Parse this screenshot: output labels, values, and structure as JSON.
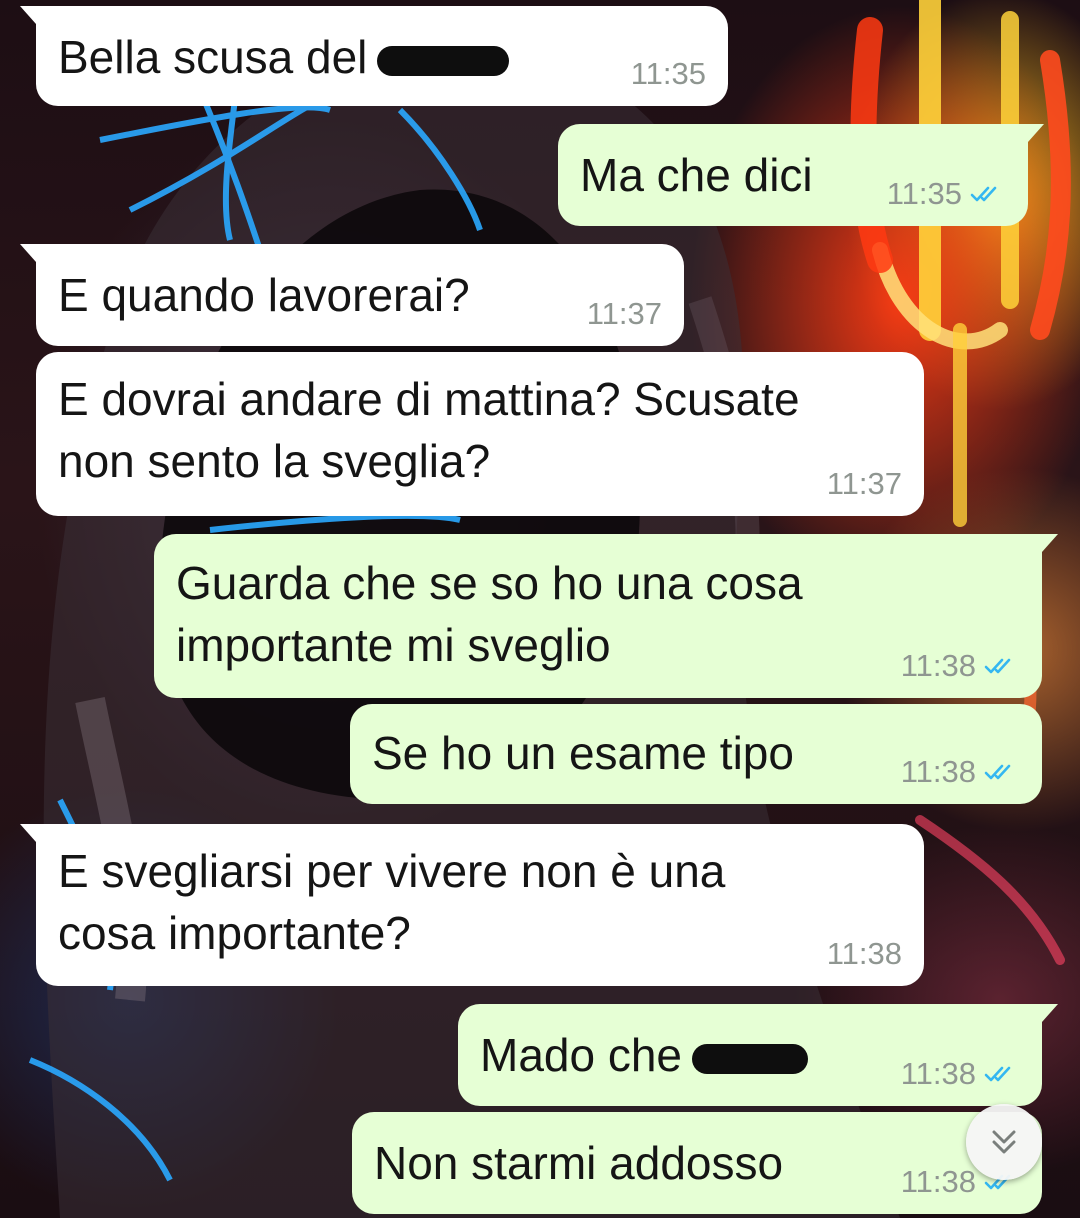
{
  "messages": [
    {
      "direction": "incoming",
      "text": "Bella scusa del",
      "redacted_suffix": true,
      "time": "11:35"
    },
    {
      "direction": "outgoing",
      "text": "Ma che dici",
      "time": "11:35",
      "status": "read"
    },
    {
      "direction": "incoming",
      "text": "E quando lavorerai?",
      "time": "11:37"
    },
    {
      "direction": "incoming",
      "text_lines": [
        "E dovrai andare di mattina? Scusate",
        "non sento la sveglia?"
      ],
      "time": "11:37"
    },
    {
      "direction": "outgoing",
      "text_lines": [
        "Guarda che se so ho una cosa",
        "importante mi sveglio"
      ],
      "time": "11:38",
      "status": "read"
    },
    {
      "direction": "outgoing",
      "text": "Se ho un esame tipo",
      "time": "11:38",
      "status": "read"
    },
    {
      "direction": "incoming",
      "text_lines": [
        "E svegliarsi per vivere non è una",
        "cosa importante?"
      ],
      "time": "11:38"
    },
    {
      "direction": "outgoing",
      "text": "Mado che",
      "redacted_suffix": true,
      "time": "11:38",
      "status": "read"
    },
    {
      "direction": "outgoing",
      "text": "Non starmi addosso",
      "time": "11:38",
      "status": "read"
    }
  ],
  "icons": {
    "read_receipt": "double-check-icon",
    "scroll_down": "double-chevron-down-icon"
  },
  "colors": {
    "incoming_bubble": "#ffffff",
    "outgoing_bubble": "#e6ffd5",
    "read_tick": "#34b7f1",
    "timestamp": "#8f9691"
  }
}
